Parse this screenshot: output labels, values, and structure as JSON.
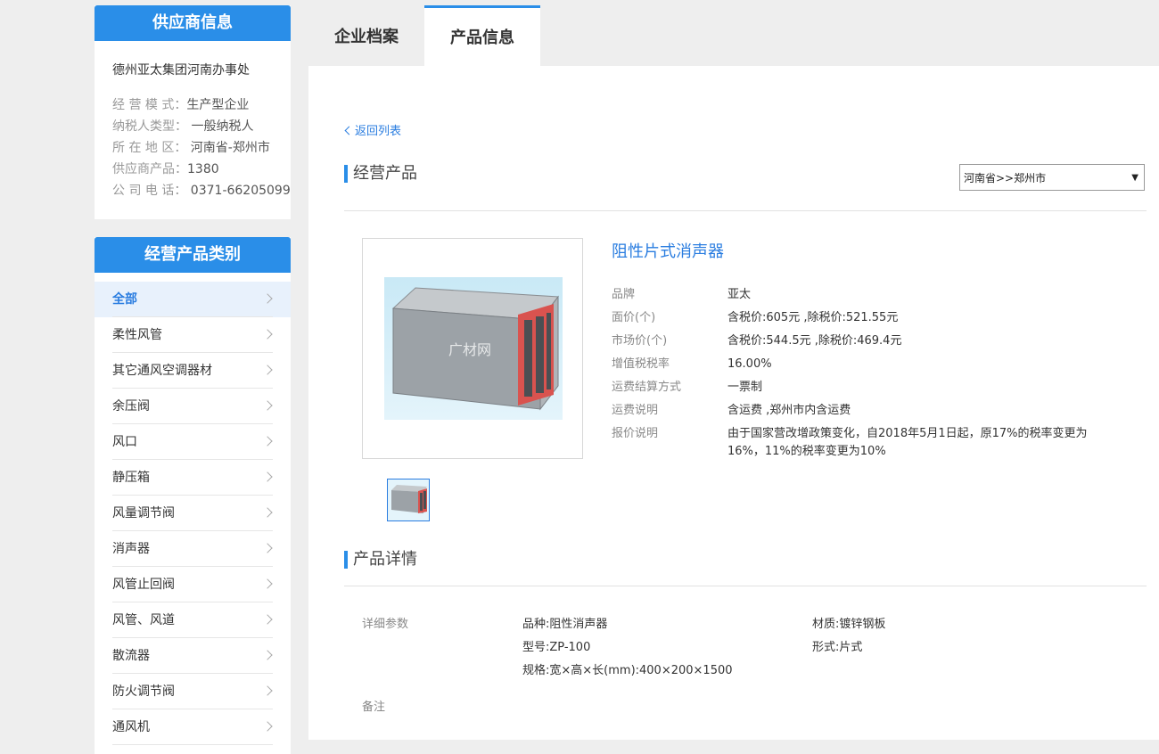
{
  "supplier": {
    "header": "供应商信息",
    "name": "德州亚太集团河南办事处",
    "fields": [
      {
        "k": "经 营 模 式：",
        "v": "生产型企业"
      },
      {
        "k": "纳税人类型：",
        "v": " 一般纳税人"
      },
      {
        "k": "所 在 地 区：",
        "v": " 河南省-郑州市"
      },
      {
        "k": "供应商产品：",
        "v": "1380"
      },
      {
        "k": "公 司 电 话：",
        "v": " 0371-66205099"
      }
    ]
  },
  "categories": {
    "header": "经营产品类别",
    "items": [
      {
        "label": "全部",
        "active": true
      },
      {
        "label": "柔性风管"
      },
      {
        "label": "其它通风空调器材"
      },
      {
        "label": "余压阀"
      },
      {
        "label": "风口"
      },
      {
        "label": "静压箱"
      },
      {
        "label": "风量调节阀"
      },
      {
        "label": "消声器"
      },
      {
        "label": "风管止回阀"
      },
      {
        "label": "风管、风道"
      },
      {
        "label": "散流器"
      },
      {
        "label": "防火调节阀"
      },
      {
        "label": "通风机"
      }
    ]
  },
  "tabs": [
    {
      "label": "企业档案"
    },
    {
      "label": "产品信息"
    }
  ],
  "back_link": "返回列表",
  "section1_title": "经营产品",
  "region_select": {
    "value": "河南省>>郑州市"
  },
  "product": {
    "title": "阻性片式消声器",
    "watermark": "广材网",
    "attrs": [
      {
        "k": "品牌",
        "v": "亚太"
      },
      {
        "k": "面价(个)",
        "v": " 含税价:605元 ,除税价:521.55元"
      },
      {
        "k": "市场价(个)",
        "v": " 含税价:544.5元 ,除税价:469.4元"
      },
      {
        "k": "增值税税率",
        "v": " 16.00%"
      },
      {
        "k": "运费结算方式",
        "v": "一票制"
      },
      {
        "k": "运费说明",
        "v": " 含运费 ,郑州市内含运费"
      },
      {
        "k": "报价说明",
        "v": " 由于国家营改增政策变化，自2018年5月1日起，原17%的税率变更为16%，11%的税率变更为10%"
      }
    ]
  },
  "section2_title": "产品详情",
  "detail": {
    "params_label": "详细参数",
    "variety": "品种:阻性消声器",
    "model": "型号:ZP-100",
    "spec": "规格:宽×高×长(mm):400×200×1500",
    "material": "材质:镀锌钢板",
    "form": "形式:片式",
    "remark_label": "备注"
  },
  "colors": {
    "accent": "#2a8ee8",
    "link": "#2a7de0"
  }
}
